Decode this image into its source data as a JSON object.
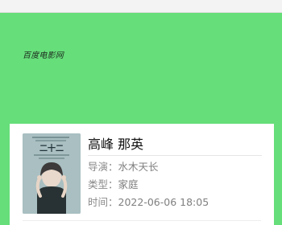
{
  "header": {
    "logo_text": "百度电影网"
  },
  "movie": {
    "poster_caption": "二十二",
    "title": "高峰 那英",
    "director_label": "导演：",
    "director": "水木天长",
    "genre_label": "类型：",
    "genre": "家庭",
    "time_label": "时间：",
    "time": "2022-06-06 18:05"
  },
  "colors": {
    "header_bg": "#66de7a",
    "card_bg": "#ffffff",
    "poster_bg": "#a9bfc1"
  }
}
